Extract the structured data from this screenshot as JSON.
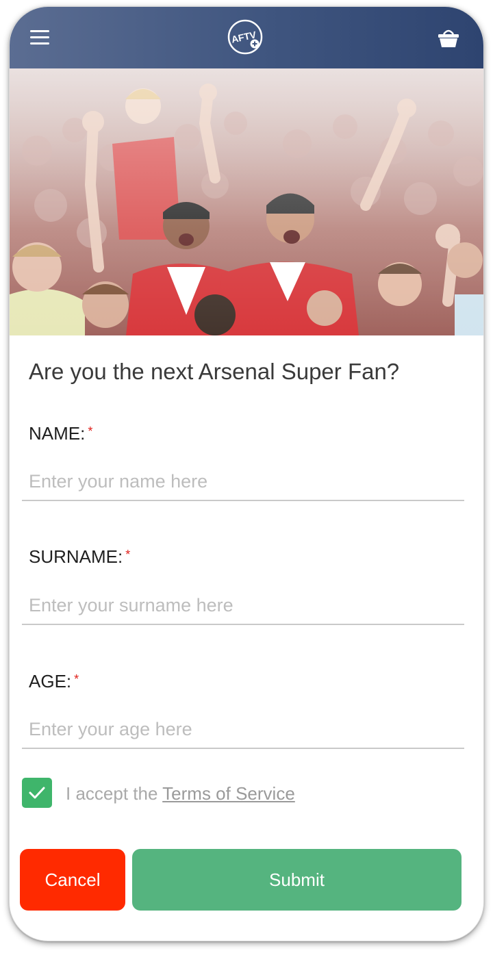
{
  "header": {
    "menu_icon": "hamburger-menu-icon",
    "logo_text": "AFTV",
    "cart_icon": "basket-icon"
  },
  "hero": {
    "image": "arsenal-fans-celebrating-photo"
  },
  "form": {
    "headline": "Are you the next Arsenal Super Fan?",
    "name": {
      "label": "NAME:",
      "required_mark": "*",
      "placeholder": "Enter your name here",
      "value": ""
    },
    "surname": {
      "label": "SURNAME:",
      "required_mark": "*",
      "placeholder": "Enter your surname here",
      "value": ""
    },
    "age": {
      "label": "AGE:",
      "required_mark": "*",
      "placeholder": "Enter your age here",
      "value": ""
    },
    "terms": {
      "checked": true,
      "prefix": "I accept the ",
      "link_text": "Terms of Service"
    },
    "cancel_label": "Cancel",
    "submit_label": "Submit"
  },
  "colors": {
    "header_start": "#5b6d92",
    "header_end": "#2e4470",
    "cancel": "#ff2a00",
    "submit": "#55b47f",
    "checkbox": "#3fb56b",
    "required": "#e0201b"
  }
}
